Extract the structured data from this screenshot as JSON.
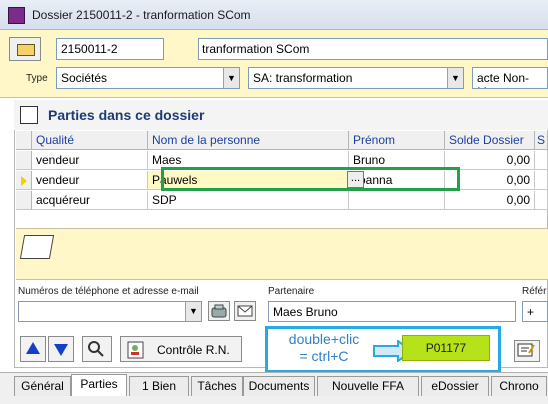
{
  "window": {
    "title": "Dossier 2150011-2 - tranformation SCom"
  },
  "dossier": {
    "number": "2150011-2",
    "description": "tranformation SCom"
  },
  "type": {
    "label": "Type",
    "category": "Sociétés",
    "subtype": "SA: transformation",
    "act": "acte Non-Mu"
  },
  "parties": {
    "title": "Parties dans ce dossier",
    "columns": [
      "Qualité",
      "Nom de la personne",
      "Prénom",
      "Solde Dossier",
      "S"
    ],
    "rows": [
      {
        "qualite": "vendeur",
        "nom": "Maes",
        "prenom": "Bruno",
        "solde": "0,00"
      },
      {
        "qualite": "vendeur",
        "nom": "Pauwels",
        "prenom": "Joanna",
        "solde": "0,00"
      },
      {
        "qualite": "acquéreur",
        "nom": "SDP",
        "prenom": "",
        "solde": "0,00"
      }
    ],
    "ellipsis": "..."
  },
  "contact": {
    "label": "Numéros de téléphone et adresse e-mail",
    "value": ""
  },
  "partner": {
    "label": "Partenaire",
    "value": "Maes Bruno"
  },
  "reference": {
    "label": "Référ",
    "value": "+"
  },
  "toolbar": {
    "controle_label": "Contrôle R.N."
  },
  "hint": {
    "text_line1": "double+clic",
    "text_line2": "= ctrl+C",
    "code": "P01177"
  },
  "tabs": [
    {
      "label": "Général",
      "active": false
    },
    {
      "label": "Parties",
      "active": true
    },
    {
      "label": "1 Bien",
      "active": false
    },
    {
      "label": "Tâches",
      "active": false
    },
    {
      "label": "Documents",
      "active": false
    },
    {
      "label": "Nouvelle FFA",
      "active": false
    },
    {
      "label": "eDossier",
      "active": false
    },
    {
      "label": "Chrono",
      "active": false
    }
  ],
  "colors": {
    "highlight_green": "#22a04a",
    "hint_blue": "#27a9e1",
    "code_lime": "#b6e21a",
    "band_yellow": "#fff7c8"
  }
}
